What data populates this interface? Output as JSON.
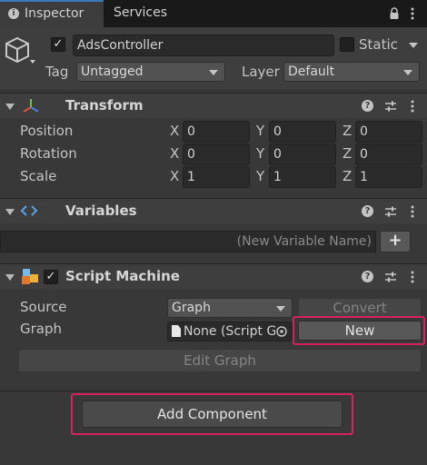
{
  "tabs": [
    {
      "label": "Inspector",
      "icon": "info-icon"
    },
    {
      "label": "Services"
    }
  ],
  "tab_controls": {
    "lock": "lock-icon",
    "menu": "more-icon"
  },
  "object": {
    "name": "AdsController",
    "active": true,
    "static_label": "Static",
    "static": false,
    "tag_label": "Tag",
    "tag_value": "Untagged",
    "layer_label": "Layer",
    "layer_value": "Default"
  },
  "transform": {
    "title": "Transform",
    "rows": [
      {
        "label": "Position",
        "x": "0",
        "y": "0",
        "z": "0"
      },
      {
        "label": "Rotation",
        "x": "0",
        "y": "0",
        "z": "0"
      },
      {
        "label": "Scale",
        "x": "1",
        "y": "1",
        "z": "1"
      }
    ],
    "axes": [
      "X",
      "Y",
      "Z"
    ]
  },
  "variables": {
    "title": "Variables",
    "placeholder": "(New Variable Name)",
    "add_label": "+"
  },
  "script_machine": {
    "title": "Script Machine",
    "enabled": true,
    "source_label": "Source",
    "source_value": "Graph",
    "convert_label": "Convert",
    "graph_label": "Graph",
    "graph_value": "None (Script G",
    "new_label": "New",
    "edit_graph_label": "Edit Graph"
  },
  "add_component_label": "Add Component",
  "colors": {
    "accent": "#3a79bb",
    "highlight": "#d8215d",
    "background": "#383838"
  }
}
